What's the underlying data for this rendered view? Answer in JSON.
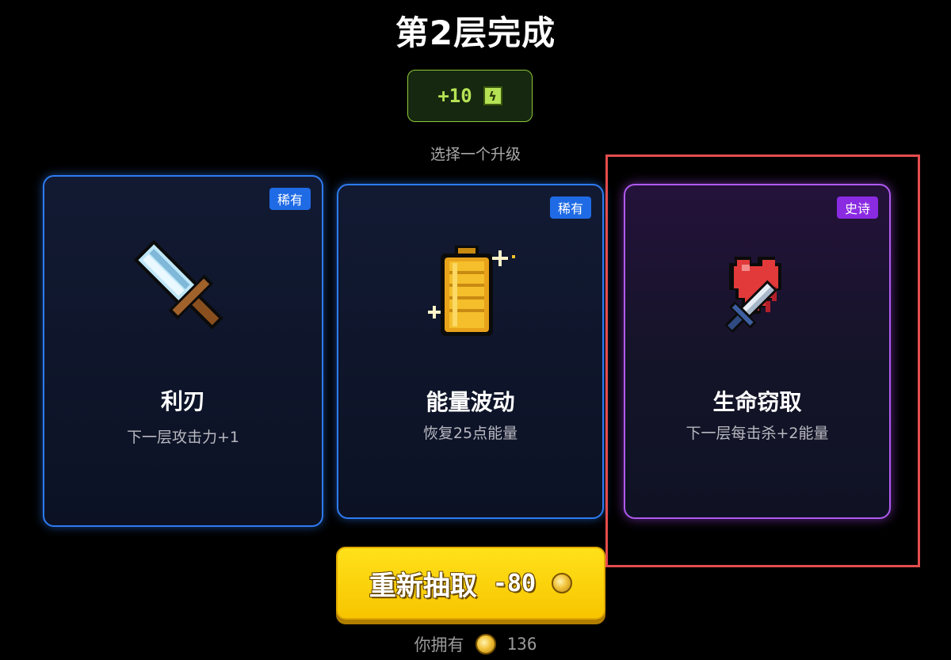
{
  "title": "第2层完成",
  "reward": {
    "amount": "+10",
    "icon": "energy-icon",
    "color": "#b5e255"
  },
  "subtitle": "选择一个升级",
  "cards": [
    {
      "badge": "稀有",
      "rarity": "rare",
      "icon": "sword-icon",
      "name": "利刃",
      "desc": "下一层攻击力+1"
    },
    {
      "badge": "稀有",
      "rarity": "rare",
      "icon": "battery-icon",
      "name": "能量波动",
      "desc": "恢复25点能量"
    },
    {
      "badge": "史诗",
      "rarity": "epic",
      "icon": "heart-sword-icon",
      "name": "生命窃取",
      "desc": "下一层每击杀+2能量"
    }
  ],
  "reroll": {
    "label": "重新抽取",
    "cost": "-80",
    "icon": "coin-icon"
  },
  "owned": {
    "label": "你拥有",
    "count": "136",
    "icon": "coin-icon"
  },
  "colors": {
    "rare_border": "#2e7bf2",
    "epic_border": "#b05af0",
    "highlight": "#e44c4c",
    "button": "#ffd60a"
  }
}
